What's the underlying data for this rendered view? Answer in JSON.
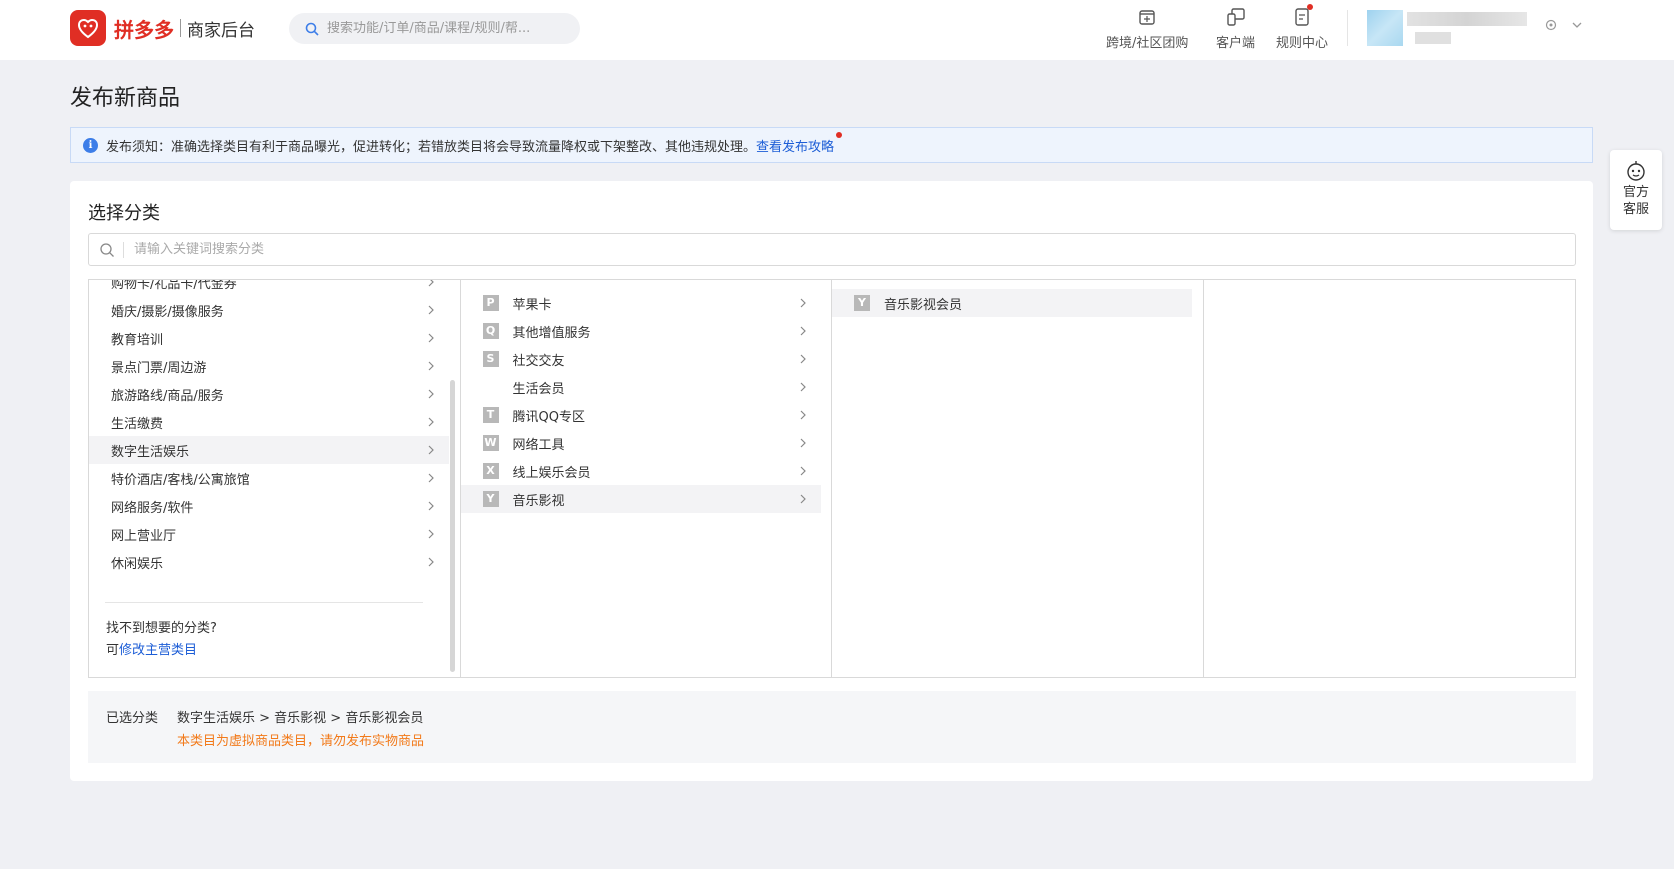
{
  "header": {
    "brand": "拼多多",
    "subtitle": "商家后台",
    "search_placeholder": "搜索功能/订单/商品/课程/规则/帮...",
    "nav": [
      {
        "label": "跨境/社区团购",
        "icon": "store-icon"
      },
      {
        "label": "客户端",
        "icon": "devices-icon"
      },
      {
        "label": "规则中心",
        "icon": "document-icon"
      }
    ]
  },
  "page": {
    "title": "发布新商品",
    "notice_text": "发布须知：准确选择类目有利于商品曝光，促进转化；若错放类目将会导致流量降权或下架整改、其他违规处理。",
    "notice_link": "查看发布攻略"
  },
  "category": {
    "title": "选择分类",
    "search_placeholder": "请输入关键词搜索分类",
    "col1": [
      {
        "label": "购物卡/礼品卡/代金券"
      },
      {
        "label": "婚庆/摄影/摄像服务"
      },
      {
        "label": "教育培训"
      },
      {
        "label": "景点门票/周边游"
      },
      {
        "label": "旅游路线/商品/服务"
      },
      {
        "label": "生活缴费"
      },
      {
        "label": "数字生活娱乐",
        "active": true
      },
      {
        "label": "特价酒店/客栈/公寓旅馆"
      },
      {
        "label": "网络服务/软件"
      },
      {
        "label": "网上营业厅"
      },
      {
        "label": "休闲娱乐"
      }
    ],
    "help_question": "找不到想要的分类?",
    "help_prefix": "可",
    "help_link": "修改主营类目",
    "col2": [
      {
        "letter": "P",
        "label": "苹果卡"
      },
      {
        "letter": "Q",
        "label": "其他增值服务"
      },
      {
        "letter": "S",
        "label": "社交交友"
      },
      {
        "letter": "",
        "label": "生活会员"
      },
      {
        "letter": "T",
        "label": "腾讯QQ专区"
      },
      {
        "letter": "W",
        "label": "网络工具"
      },
      {
        "letter": "X",
        "label": "线上娱乐会员"
      },
      {
        "letter": "Y",
        "label": "音乐影视",
        "active": true
      }
    ],
    "col3": [
      {
        "letter": "Y",
        "label": "音乐影视会员",
        "active": true
      }
    ]
  },
  "selected": {
    "label": "已选分类",
    "path": "数字生活娱乐 > 音乐影视 > 音乐影视会员",
    "warning": "本类目为虚拟商品类目，请勿发布实物商品"
  },
  "service": {
    "line1": "官方",
    "line2": "客服"
  }
}
